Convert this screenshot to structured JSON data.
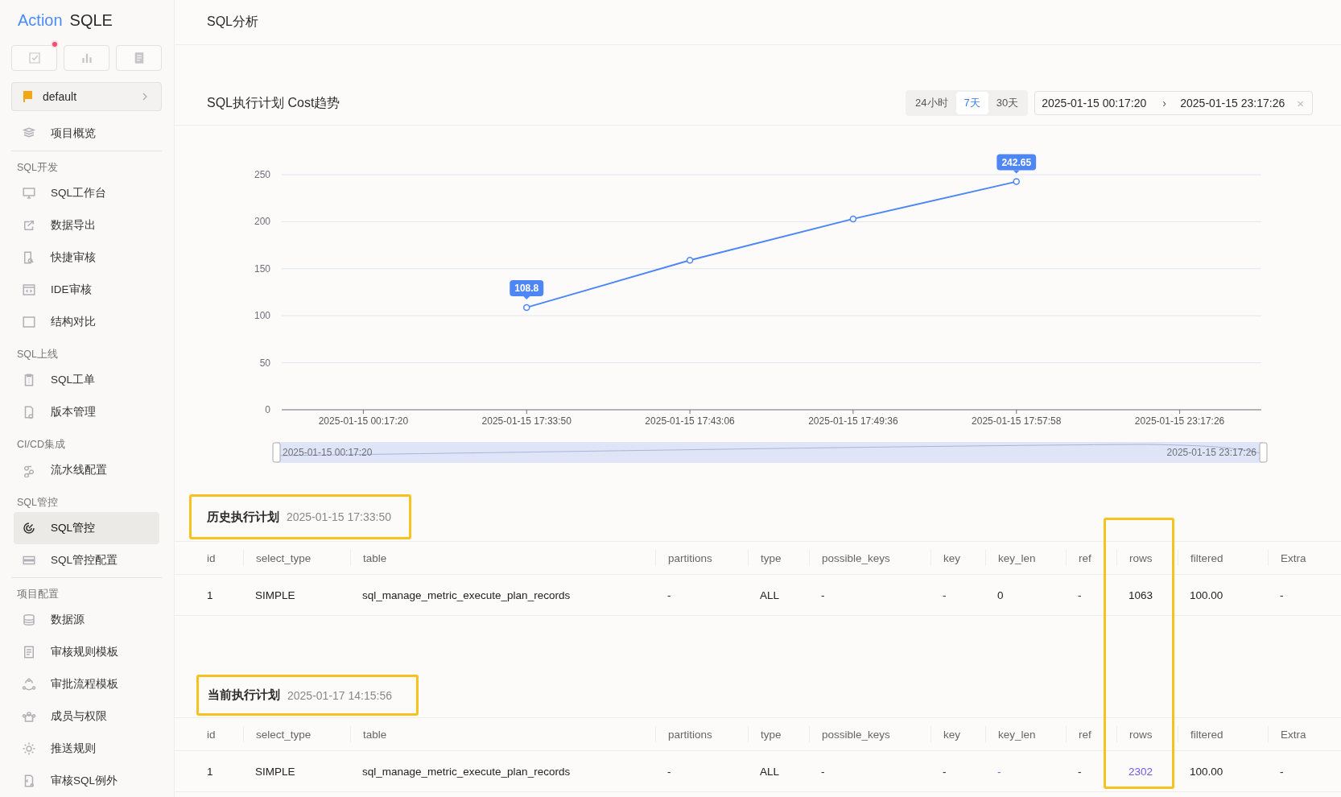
{
  "sidebar": {
    "logo": {
      "brand": "Action",
      "product": "SQLE"
    },
    "top_buttons": [
      {
        "notification": true
      },
      {
        "notification": false
      },
      {
        "notification": false
      }
    ],
    "project": {
      "name": "default"
    },
    "overview": {
      "label": "项目概览",
      "selected": false
    },
    "sections": [
      {
        "title": "SQL开发",
        "divider_before": false,
        "items": [
          {
            "label": "SQL工作台",
            "selected": false
          },
          {
            "label": "数据导出",
            "selected": false
          },
          {
            "label": "快捷审核",
            "selected": false
          },
          {
            "label": "IDE审核",
            "selected": false
          },
          {
            "label": "结构对比",
            "selected": false
          }
        ]
      },
      {
        "title": "SQL上线",
        "divider_before": false,
        "items": [
          {
            "label": "SQL工单",
            "selected": false
          },
          {
            "label": "版本管理",
            "selected": false
          }
        ]
      },
      {
        "title": "CI/CD集成",
        "divider_before": false,
        "items": [
          {
            "label": "流水线配置",
            "selected": false
          }
        ]
      },
      {
        "title": "SQL管控",
        "divider_before": false,
        "items": [
          {
            "label": "SQL管控",
            "selected": true
          },
          {
            "label": "SQL管控配置",
            "selected": false
          }
        ]
      },
      {
        "title": "项目配置",
        "divider_before": true,
        "items": [
          {
            "label": "数据源",
            "selected": false
          },
          {
            "label": "审核规则模板",
            "selected": false
          },
          {
            "label": "审批流程模板",
            "selected": false
          },
          {
            "label": "成员与权限",
            "selected": false
          },
          {
            "label": "推送规则",
            "selected": false
          },
          {
            "label": "审核SQL例外",
            "selected": false
          }
        ]
      }
    ]
  },
  "page": {
    "title": "SQL分析"
  },
  "trend": {
    "title": "SQL执行计划 Cost趋势",
    "ranges": [
      {
        "label": "24小时",
        "selected": false
      },
      {
        "label": "7天",
        "selected": true
      },
      {
        "label": "30天",
        "selected": false
      }
    ],
    "date_range": {
      "start": "2025-01-15 00:17:20",
      "separator": "›",
      "end": "2025-01-15 23:17:26",
      "clear": "×"
    },
    "chart_data": {
      "type": "line",
      "categories": [
        "2025-01-15 00:17:20",
        "2025-01-15 17:33:50",
        "2025-01-15 17:43:06",
        "2025-01-15 17:49:36",
        "2025-01-15 17:57:58",
        "2025-01-15 23:17:26"
      ],
      "series": [
        {
          "color": "#4e86f5",
          "marker": true,
          "values": [
            null,
            108.8,
            159,
            203,
            242.65,
            null
          ]
        }
      ],
      "ylim": [
        0,
        250
      ],
      "yticks": [
        0,
        50,
        100,
        150,
        200,
        250
      ],
      "grid": true,
      "annotations": [
        {
          "x": "2025-01-15 17:33:50",
          "y": 108.8,
          "text": "108.8"
        },
        {
          "x": "2025-01-15 17:57:58",
          "y": 242.65,
          "text": "242.65"
        }
      ]
    },
    "zoom": {
      "start": "2025-01-15 00:17:20",
      "end": "2025-01-15 23:17:26"
    }
  },
  "plans": [
    {
      "title": "历史执行计划",
      "time": "2025-01-15 17:33:50",
      "columns": [
        "id",
        "select_type",
        "table",
        "partitions",
        "type",
        "possible_keys",
        "key",
        "key_len",
        "ref",
        "rows",
        "filtered",
        "Extra"
      ],
      "rows": [
        [
          {
            "text": "1",
            "changed": false
          },
          {
            "text": "SIMPLE",
            "changed": false
          },
          {
            "text": "sql_manage_metric_execute_plan_records",
            "changed": false
          },
          {
            "text": "-",
            "changed": false
          },
          {
            "text": "ALL",
            "changed": false
          },
          {
            "text": "-",
            "changed": false
          },
          {
            "text": "-",
            "changed": false
          },
          {
            "text": "0",
            "changed": false
          },
          {
            "text": "-",
            "changed": false
          },
          {
            "text": "1063",
            "changed": false
          },
          {
            "text": "100.00",
            "changed": false
          },
          {
            "text": "-",
            "changed": false
          }
        ]
      ]
    },
    {
      "title": "当前执行计划",
      "time": "2025-01-17 14:15:56",
      "columns": [
        "id",
        "select_type",
        "table",
        "partitions",
        "type",
        "possible_keys",
        "key",
        "key_len",
        "ref",
        "rows",
        "filtered",
        "Extra"
      ],
      "rows": [
        [
          {
            "text": "1",
            "changed": false
          },
          {
            "text": "SIMPLE",
            "changed": false
          },
          {
            "text": "sql_manage_metric_execute_plan_records",
            "changed": false
          },
          {
            "text": "-",
            "changed": false
          },
          {
            "text": "ALL",
            "changed": false
          },
          {
            "text": "-",
            "changed": false
          },
          {
            "text": "-",
            "changed": false
          },
          {
            "text": "-",
            "changed": true
          },
          {
            "text": "-",
            "changed": false
          },
          {
            "text": "2302",
            "changed": true
          },
          {
            "text": "100.00",
            "changed": false
          },
          {
            "text": "-",
            "changed": false
          }
        ]
      ]
    }
  ]
}
